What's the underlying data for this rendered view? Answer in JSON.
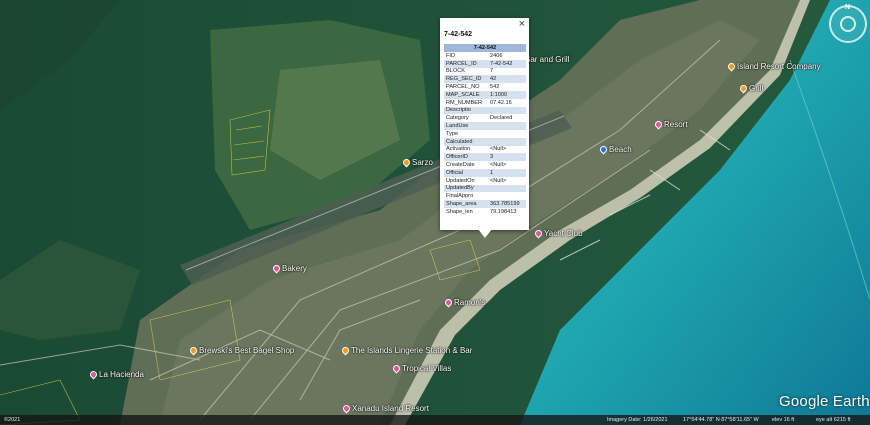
{
  "popup": {
    "title": "7-42-542",
    "close_glyph": "×",
    "table_header": "7-42-542",
    "rows": [
      {
        "field": "FID",
        "value": "2406"
      },
      {
        "field": "PARCEL_ID",
        "value": "7-42-542"
      },
      {
        "field": "BLOCK",
        "value": "7"
      },
      {
        "field": "REG_SEC_ID",
        "value": "42"
      },
      {
        "field": "PARCEL_NO",
        "value": "542"
      },
      {
        "field": "MAP_SCALE",
        "value": "1:1000"
      },
      {
        "field": "RM_NUMBER",
        "value": "07.42.16"
      },
      {
        "field": "Descriptio",
        "value": ""
      },
      {
        "field": "Category",
        "value": "Declared"
      },
      {
        "field": "LandUse",
        "value": ""
      },
      {
        "field": "Type",
        "value": ""
      },
      {
        "field": "Calculated",
        "value": ""
      },
      {
        "field": "Activation",
        "value": "<Null>"
      },
      {
        "field": "OfficerID",
        "value": "3"
      },
      {
        "field": "CreateDate",
        "value": "<Null>"
      },
      {
        "field": "Official",
        "value": "1"
      },
      {
        "field": "UpdatedOn",
        "value": "<Null>"
      },
      {
        "field": "UpdatedBy",
        "value": ""
      },
      {
        "field": "FinalAppro",
        "value": ""
      },
      {
        "field": "Shape_area",
        "value": "363.785199"
      },
      {
        "field": "Shape_len",
        "value": "79.198413"
      }
    ]
  },
  "places": [
    {
      "label": "Bar and Grill",
      "color": "pink"
    },
    {
      "label": "Island Resort Company",
      "color": "orange"
    },
    {
      "label": "Grill",
      "color": "orange"
    },
    {
      "label": "Resort",
      "color": "pink"
    },
    {
      "label": "Beach",
      "color": "blue"
    },
    {
      "label": "Sarzo",
      "color": "orange"
    },
    {
      "label": "Yacht Club",
      "color": "pink"
    },
    {
      "label": "Bakery",
      "color": "pink"
    },
    {
      "label": "Brewski's Best Bagel Shop",
      "color": "orange"
    },
    {
      "label": "The Islands Lingerie Station & Bar",
      "color": "orange"
    },
    {
      "label": "La Hacienda",
      "color": "pink"
    },
    {
      "label": "Tropical Villas",
      "color": "pink"
    },
    {
      "label": "Xanadu Island Resort",
      "color": "pink"
    },
    {
      "label": "Ramon's",
      "color": "pink"
    }
  ],
  "nav": {
    "north": "N"
  },
  "logo": "Google Earth",
  "status": {
    "left": "©2021",
    "imagery": "Imagery Date: 1/26/2021",
    "coords": "17°54'44.78\" N   87°58'11.65\" W",
    "elev": "elev   16 ft",
    "eye": "eye alt  6215 ft"
  },
  "colors": {
    "lagoon": "#1f5a3c",
    "sea": "#1fa7ad",
    "deep_sea": "#0f7f9b",
    "land": "#4a6a3c",
    "popup_header": "#9fb8d9"
  }
}
